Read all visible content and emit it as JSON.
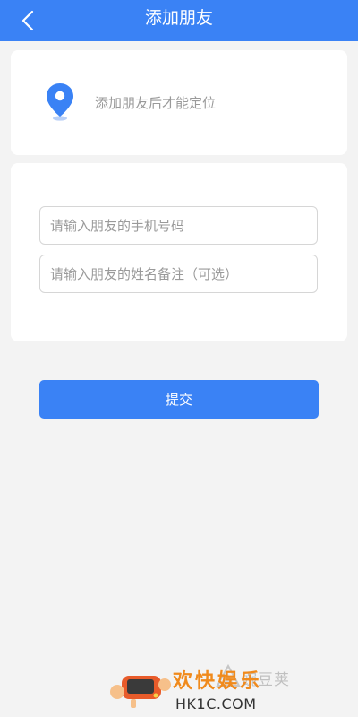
{
  "header": {
    "title": "添加朋友",
    "back_icon": "chevron-left-icon"
  },
  "location_card": {
    "icon": "location-pin-icon",
    "text": "添加朋友后才能定位"
  },
  "form": {
    "phone_placeholder": "请输入朋友的手机号码",
    "name_placeholder": "请输入朋友的姓名备注（可选）"
  },
  "submit": {
    "label": "提交"
  },
  "watermark": {
    "ghost_text": "豌豆荚",
    "title": "欢快娱乐",
    "subtitle": "HK1C.COM"
  },
  "colors": {
    "accent": "#3a82f5",
    "background": "#f3f3f3",
    "watermark_orange": "#f08a1c"
  }
}
